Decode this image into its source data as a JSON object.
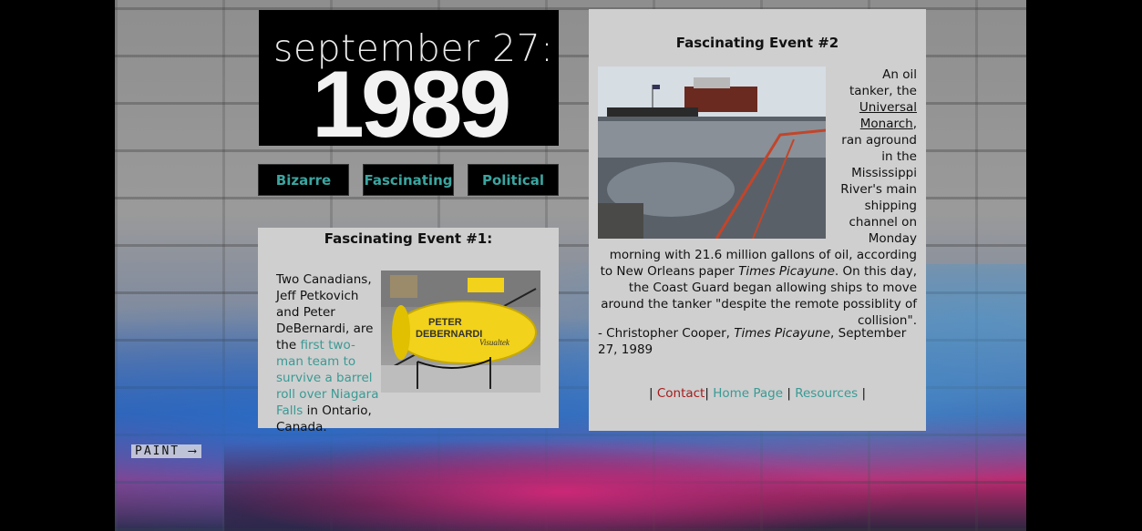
{
  "banner": {
    "date": "september 27:",
    "year": "1989"
  },
  "nav": [
    {
      "label": "Bizarre"
    },
    {
      "label": "Fascinating"
    },
    {
      "label": "Political"
    }
  ],
  "background": {
    "paint_label": "PAINT"
  },
  "event1": {
    "title": "Fascinating Event #1:",
    "text_before": "Two Canadians, Jeff Petkovich and Peter DeBernardi, are the ",
    "link": "first two-man team to survive a barrel roll over Niagara Falls",
    "text_after": " in Ontario, Canada.",
    "image_caption_words": [
      "PETER",
      "DEBERNARDI",
      "Visualtek"
    ]
  },
  "event2": {
    "title": "Fascinating Event #2",
    "p1_a": "An oil tanker, the ",
    "p1_link": "Universal Monarch",
    "p1_b": ", ran aground in the Mississippi River's main shipping channel on Monday morning with 21.6 million gallons of oil, according to New Orleans paper ",
    "p1_em": "Times Picayune",
    "p1_c": ". On this day, the Coast Guard began allowing ships to move around the tanker \"despite the remote possiblity of collision\".",
    "p2_a": "- Christopher Cooper, ",
    "p2_em": "Times Picayune",
    "p2_b": ", September 27, 1989"
  },
  "footer_links": {
    "sep": "|",
    "contact": "Contact",
    "home": "Home Page",
    "resources": "Resources"
  },
  "colors": {
    "link_teal": "#3a9a94",
    "contact_red": "#a51b1b",
    "panel_bg": "#cfcfcf"
  }
}
